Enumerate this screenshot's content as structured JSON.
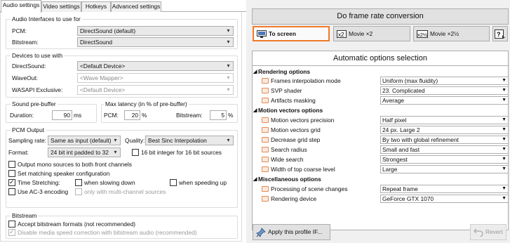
{
  "tabs": [
    "Audio settings",
    "Video settings",
    "Hotkeys",
    "Advanced settings"
  ],
  "audio_interfaces": {
    "title": "Audio Interfaces to use for",
    "pcm_label": "PCM:",
    "pcm_value": "DirectSound (default)",
    "bitstream_label": "Bitstream:",
    "bitstream_value": "DirectSound"
  },
  "devices": {
    "title": "Devices to use with",
    "directsound_label": "DirectSound:",
    "directsound_value": "<Default Device>",
    "waveout_label": "WaveOut:",
    "waveout_value": "<Wave Mapper>",
    "wasapi_label": "WASAPI Exclusive:",
    "wasapi_value": "<Default Device>"
  },
  "prebuffer": {
    "title": "Sound pre-buffer",
    "duration_label": "Duration:",
    "duration_value": "90",
    "duration_unit": "ms"
  },
  "latency": {
    "title": "Max latency (in % of pre-buffer)",
    "pcm_label": "PCM:",
    "pcm_value": "20",
    "pcm_unit": "%",
    "bitstream_label": "Bitstream:",
    "bitstream_value": "5",
    "bitstream_unit": "%"
  },
  "pcm_output": {
    "title": "PCM Output",
    "sampling_label": "Sampling rate:",
    "sampling_value": "Same as input (default)",
    "quality_label": "Quality:",
    "quality_value": "Best Sinc Interpolation",
    "format_label": "Format:",
    "format_value": "24 bit int padded to 32",
    "int16_label": "16 bit integer for 16 bit sources",
    "mono_label": "Output mono sources to both front channels",
    "speaker_label": "Set matching speaker configuration",
    "stretch_label": "Time Stretching:",
    "slowing_label": "when slowing down",
    "speeding_label": "when speeding up",
    "ac3_label": "Use AC-3 encoding",
    "multich_label": "only with multi-channel sources"
  },
  "bitstream": {
    "title": "Bitstream",
    "accept_label": "Accept bitstream formats (not recommended)",
    "disable_label": "Disable media speed correction with bitstream audio (recommended)"
  },
  "right": {
    "main_button": "Do frame rate conversion",
    "to_screen": "To screen",
    "movie2": "Movie ×2",
    "movie25": "Movie ×2½",
    "help_icon_text": "?",
    "header": "Automatic options selection",
    "apply_button": "Apply this profile IF...",
    "revert_button": "Revert"
  },
  "sections": [
    {
      "title": "Rendering options",
      "rows": [
        {
          "label": "Frames interpolation mode",
          "value": "Uniform (max fluidity)"
        },
        {
          "label": "SVP shader",
          "value": "23. Complicated"
        },
        {
          "label": "Artifacts masking",
          "value": "Average"
        }
      ]
    },
    {
      "title": "Motion vectors options",
      "rows": [
        {
          "label": "Motion vectors precision",
          "value": "Half pixel"
        },
        {
          "label": "Motion vectors grid",
          "value": "24 px. Large 2"
        },
        {
          "label": "Decrease grid step",
          "value": "By two with global refinement"
        },
        {
          "label": "Search radius",
          "value": "Small and fast"
        },
        {
          "label": "Wide search",
          "value": "Strongest"
        },
        {
          "label": "Width of top coarse level",
          "value": "Large"
        }
      ]
    },
    {
      "title": "Miscellaneous options",
      "rows": [
        {
          "label": "Processing of scene changes",
          "value": "Repeat frame"
        },
        {
          "label": "Rendering device",
          "value": "GeForce GTX 1070"
        }
      ]
    }
  ],
  "colors": {
    "accent": "#f07a2a",
    "section_icon": "#e28b58"
  },
  "icons": {
    "dropdown": "▾",
    "section_marker": "▲",
    "checkmark": "✓"
  }
}
